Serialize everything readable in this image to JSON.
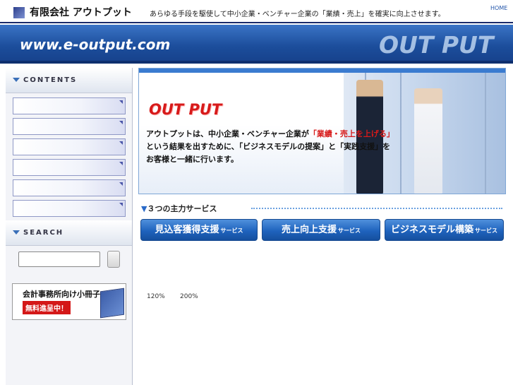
{
  "header": {
    "company": "有限会社 アウトプット",
    "tagline": "あらゆる手段を駆使して中小企業・ベンチャー企業の「業績・売上」を確実に向上させます。",
    "home_link": "HOME"
  },
  "banner": {
    "url": "www.e-output.com",
    "brand": "OUT PUT"
  },
  "sidebar": {
    "contents_title": "CONTENTS",
    "search_title": "SEARCH",
    "promo_line1": "会計事務所向け小冊子",
    "promo_line2": "無料進呈中！"
  },
  "hero": {
    "brand": "OUT PUT",
    "line1_a": "アウトプットは、中小企業・ベンチャー企業が",
    "line1_b": "「業績・売上を上げる」",
    "line2_a": "という結果を出すために、",
    "line2_b": "「ビジネスモデルの提案」",
    "line2_c": "と",
    "line2_d": "「実践支援」",
    "line2_e": "を",
    "line3": "お客様と一緒に行います。"
  },
  "services": {
    "heading": "３つの主力サービス",
    "buttons": [
      {
        "label": "見込客獲得支援",
        "suffix": "サービス"
      },
      {
        "label": "売上向上支援",
        "suffix": "サービス"
      },
      {
        "label": "ビジネスモデル構築",
        "suffix": "サービス"
      }
    ]
  },
  "zoom": {
    "a": "120%",
    "b": "200%"
  },
  "colors": {
    "accent_blue": "#1f63bd",
    "highlight_red": "#d71a1a"
  }
}
